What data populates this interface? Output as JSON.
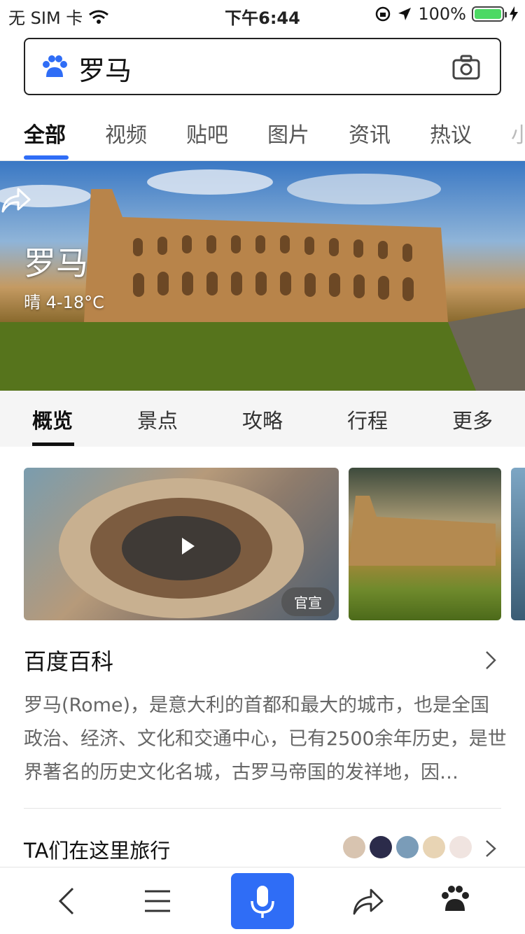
{
  "status": {
    "carrier": "无 SIM 卡",
    "time": "下午6:44",
    "battery": "100%"
  },
  "search": {
    "query": "罗马"
  },
  "category_tabs": {
    "active": "全部",
    "items": [
      "全部",
      "视频",
      "贴吧",
      "图片",
      "资讯",
      "热议",
      "小"
    ]
  },
  "hero": {
    "city": "罗马",
    "weather": "晴 4-18°C"
  },
  "sub_tabs": {
    "items": [
      "概览",
      "景点",
      "攻略",
      "行程",
      "更多"
    ],
    "active": "概览"
  },
  "media": {
    "badge": "官宣"
  },
  "baike": {
    "title": "百度百科",
    "text": "罗马(Rome)，是意大利的首都和最大的城市，也是全国政治、经济、文化和交通中心，已有2500余年历史，是世界著名的历史文化名城，古罗马帝国的发祥地，因…"
  },
  "travel": {
    "title": "TA们在这里旅行"
  },
  "colors": {
    "accent": "#2f6df6",
    "battery": "#4cd964"
  }
}
